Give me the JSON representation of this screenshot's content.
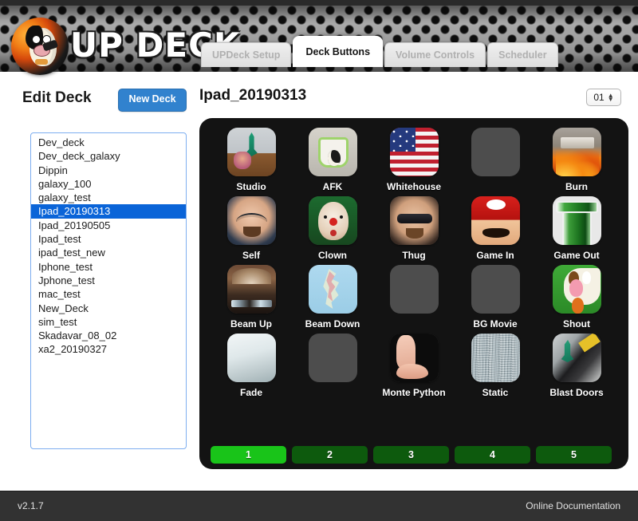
{
  "app": {
    "brand": "UP DECK",
    "logo_icon": "updeck-penguin-logo"
  },
  "tabs": [
    {
      "label": "UPDeck Setup",
      "active": false
    },
    {
      "label": "Deck Buttons",
      "active": true
    },
    {
      "label": "Volume Controls",
      "active": false
    },
    {
      "label": "Scheduler",
      "active": false
    }
  ],
  "sidebar": {
    "title": "Edit Deck",
    "new_deck_label": "New Deck",
    "decks": [
      {
        "name": "Dev_deck",
        "selected": false
      },
      {
        "name": "Dev_deck_galaxy",
        "selected": false
      },
      {
        "name": "Dippin",
        "selected": false
      },
      {
        "name": "galaxy_100",
        "selected": false
      },
      {
        "name": "galaxy_test",
        "selected": false
      },
      {
        "name": "Ipad_20190313",
        "selected": true
      },
      {
        "name": "Ipad_20190505",
        "selected": false
      },
      {
        "name": "Ipad_test",
        "selected": false
      },
      {
        "name": "ipad_test_new",
        "selected": false
      },
      {
        "name": "Iphone_test",
        "selected": false
      },
      {
        "name": "Jphone_test",
        "selected": false
      },
      {
        "name": "mac_test",
        "selected": false
      },
      {
        "name": "New_Deck",
        "selected": false
      },
      {
        "name": "sim_test",
        "selected": false
      },
      {
        "name": "Skadavar_08_02",
        "selected": false
      },
      {
        "name": "xa2_20190327",
        "selected": false
      }
    ]
  },
  "main": {
    "deck_title": "Ipad_20190313",
    "page_select": {
      "value": "01",
      "spinner_up_icon": "chevron-up-icon",
      "spinner_down_icon": "chevron-down-icon"
    },
    "buttons": [
      {
        "label": "Studio",
        "art": "art-studio",
        "empty": false
      },
      {
        "label": "AFK",
        "art": "art-afk",
        "empty": false
      },
      {
        "label": "Whitehouse",
        "art": "art-flag",
        "empty": false
      },
      {
        "label": "",
        "art": "",
        "empty": true
      },
      {
        "label": "Burn",
        "art": "art-burn",
        "empty": false
      },
      {
        "label": "Self",
        "art": "art-face-self",
        "empty": false
      },
      {
        "label": "Clown",
        "art": "art-clown",
        "empty": false
      },
      {
        "label": "Thug",
        "art": "art-thug",
        "empty": false
      },
      {
        "label": "Game In",
        "art": "art-mario",
        "empty": false
      },
      {
        "label": "Game Out",
        "art": "art-pipe",
        "empty": false
      },
      {
        "label": "Beam Up",
        "art": "art-beamup",
        "empty": false
      },
      {
        "label": "Beam Down",
        "art": "art-beamdown",
        "empty": false
      },
      {
        "label": "",
        "art": "",
        "empty": true
      },
      {
        "label": "BG Movie",
        "art": "",
        "empty": true
      },
      {
        "label": "Shout",
        "art": "art-shout",
        "empty": false
      },
      {
        "label": "Fade",
        "art": "art-fade",
        "empty": false
      },
      {
        "label": "",
        "art": "",
        "empty": true
      },
      {
        "label": "Monte Python",
        "art": "art-foot",
        "empty": false
      },
      {
        "label": "Static",
        "art": "art-static",
        "empty": false
      },
      {
        "label": "Blast Doors",
        "art": "art-blast",
        "empty": false
      }
    ],
    "pages": [
      {
        "label": "1",
        "active": true
      },
      {
        "label": "2",
        "active": false
      },
      {
        "label": "3",
        "active": false
      },
      {
        "label": "4",
        "active": false
      },
      {
        "label": "5",
        "active": false
      }
    ]
  },
  "footer": {
    "version": "v2.1.7",
    "documentation_link": "Online Documentation"
  },
  "colors": {
    "accent_blue": "#3182ce",
    "selection_blue": "#0a64d8",
    "page_active_green": "#19c419",
    "page_inactive_green": "#0d5a0d",
    "panel_dark": "#131313",
    "footer_dark": "#323232"
  }
}
